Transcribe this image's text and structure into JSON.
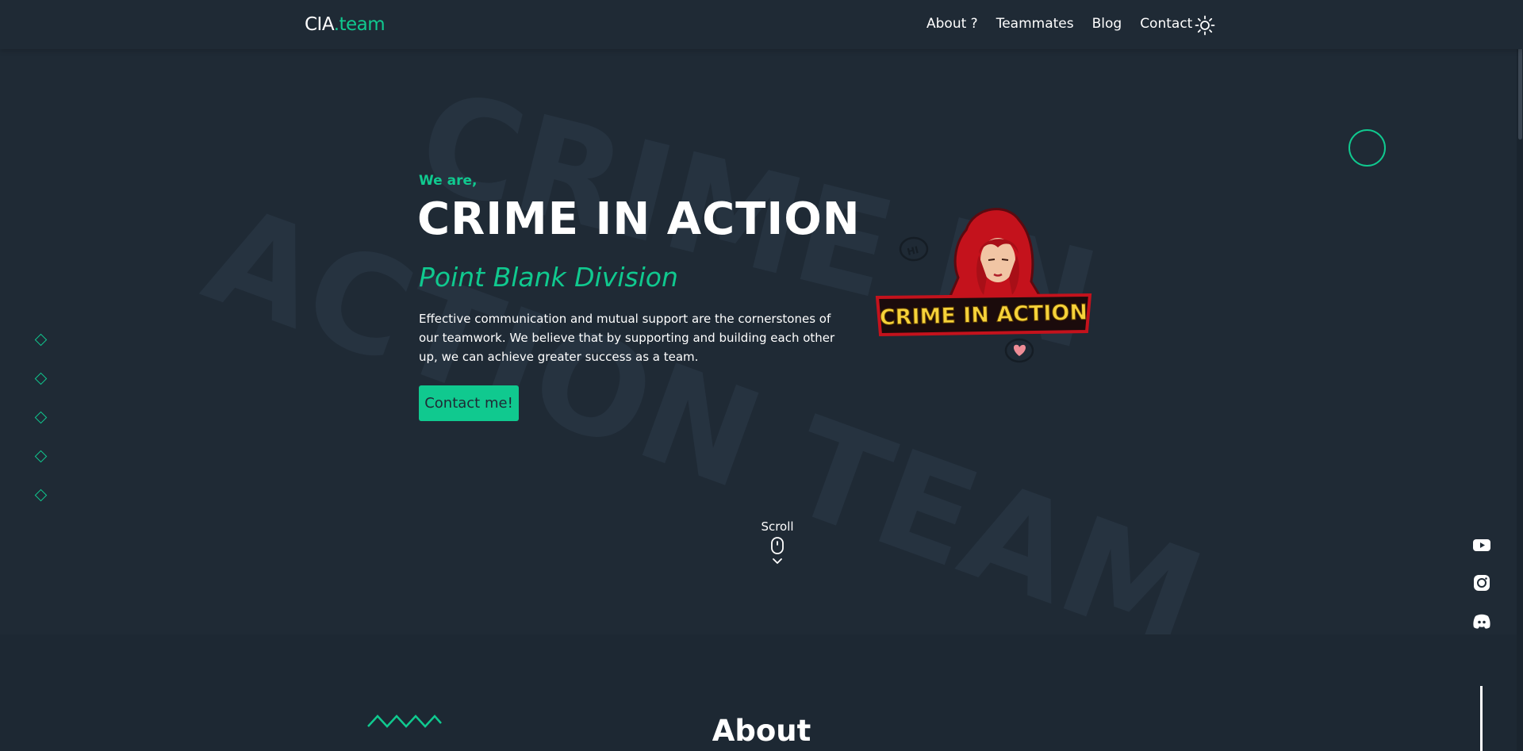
{
  "header": {
    "logo_main": "CIA",
    "logo_accent": ".team",
    "nav": [
      "About ?",
      "Teammates",
      "Blog",
      "Contact"
    ],
    "theme_toggle_icon": "sun-icon"
  },
  "watermark": {
    "line1": "CRIME IN",
    "line2": "ACTION TEAM"
  },
  "hero": {
    "intro": "We are,",
    "title": "CRIME IN ACTION",
    "division": "Point Blank Division",
    "description": "Effective communication and mutual support are the cornerstones of our teamwork. We believe that by supporting and building each other up, we can achieve greater success as a team.",
    "cta_label": "Contact me!"
  },
  "mascot": {
    "banner_text": "CRIME IN ACTION",
    "bubble_text": "HI"
  },
  "scroll": {
    "label": "Scroll",
    "icons": [
      "mouse-icon",
      "chevron-down-icon"
    ]
  },
  "socials": [
    "youtube-icon",
    "instagram-icon",
    "discord-icon"
  ],
  "about": {
    "title": "About"
  },
  "colors": {
    "background": "#1f2a35",
    "accent": "#10c98f",
    "text": "#ffffff"
  }
}
